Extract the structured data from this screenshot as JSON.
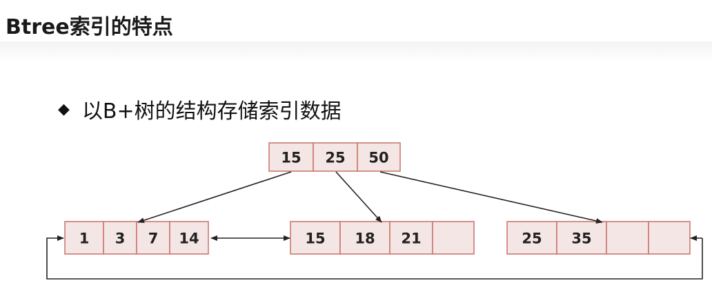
{
  "title": "Btree索引的特点",
  "bullet": {
    "icon": "diamond-bullet-icon",
    "text": "以B+树的结构存储索引数据"
  },
  "colors": {
    "cell_fill": "#f4e6e4",
    "cell_border": "#c9706a",
    "arrow": "#222222"
  },
  "tree": {
    "root": [
      "15",
      "25",
      "50"
    ],
    "leaves": [
      [
        "1",
        "3",
        "7",
        "14"
      ],
      [
        "15",
        "18",
        "21",
        ""
      ],
      [
        "25",
        "35",
        "",
        ""
      ]
    ]
  }
}
